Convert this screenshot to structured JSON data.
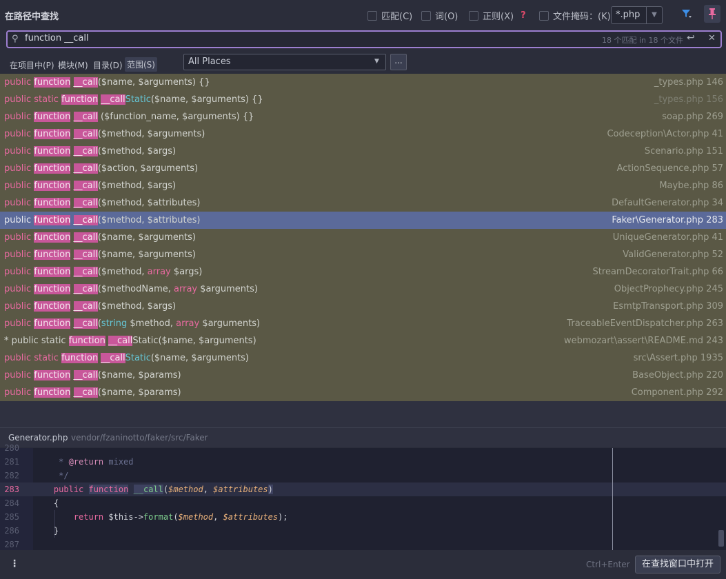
{
  "header": {
    "title": "在路径中查找",
    "options": [
      {
        "label": "匹配(C)",
        "checked": false
      },
      {
        "label": "词(O)",
        "checked": false
      },
      {
        "label": "正则(X)",
        "checked": false
      },
      {
        "label": "文件掩码：(K)",
        "checked": false
      }
    ],
    "regex_help": "?",
    "file_mask_value": "*.php",
    "filter_icon": "filter-icon",
    "pin_icon": "pin-icon"
  },
  "search": {
    "query": "function __call",
    "match_count": "18 个匹配 in 18 个文件",
    "enter_symbol": "↩",
    "close_symbol": "✕"
  },
  "scope": {
    "tabs": [
      "在项目中(P)",
      "模块(M)",
      "目录(D)",
      "范围(S)"
    ],
    "selected_tab": "范围(S)",
    "places_value": "All Places",
    "more_label": "..."
  },
  "results": [
    {
      "prefix": "public ",
      "match": [
        "function",
        "__call"
      ],
      "suffix": "($name, $arguments) {}",
      "location": "_types.php 146"
    },
    {
      "prefix": "public static ",
      "match": [
        "function",
        "__call"
      ],
      "suffix_cyan": "Static",
      "suffix": "($name, $arguments) {}",
      "location": "_types.php 156",
      "dim_location": true
    },
    {
      "prefix": "public ",
      "match": [
        "function",
        "__call"
      ],
      "suffix": " ($function_name, $arguments) {}",
      "location": "soap.php 269"
    },
    {
      "prefix": "public ",
      "match": [
        "function",
        "__call"
      ],
      "suffix": "($method, $arguments)",
      "location": "Codeception\\Actor.php 41"
    },
    {
      "prefix": "public ",
      "match": [
        "function",
        "__call"
      ],
      "suffix": "($method, $args)",
      "location": "Scenario.php 151"
    },
    {
      "prefix": "public ",
      "match": [
        "function",
        "__call"
      ],
      "suffix": "($action, $arguments)",
      "location": "ActionSequence.php 57"
    },
    {
      "prefix": "public ",
      "match": [
        "function",
        "__call"
      ],
      "suffix": "($method, $args)",
      "location": "Maybe.php 86"
    },
    {
      "prefix": "public ",
      "match": [
        "function",
        "__call"
      ],
      "suffix": "($method, $attributes)",
      "location": "DefaultGenerator.php 34"
    },
    {
      "prefix": "public ",
      "match": [
        "function",
        "__call"
      ],
      "suffix": "($method, $attributes)",
      "location": "Faker\\Generator.php 283",
      "selected": true
    },
    {
      "prefix": "public ",
      "match": [
        "function",
        "__call"
      ],
      "suffix": "($name, $arguments)",
      "location": "UniqueGenerator.php 41"
    },
    {
      "prefix": "public ",
      "match": [
        "function",
        "__call"
      ],
      "suffix": "($name, $arguments)",
      "location": "ValidGenerator.php 52"
    },
    {
      "prefix": "public ",
      "match": [
        "function",
        "__call"
      ],
      "suffix_parts": [
        "($method, ",
        "array",
        " $args)"
      ],
      "location": "StreamDecoratorTrait.php 66"
    },
    {
      "prefix": "public ",
      "match": [
        "function",
        "__call"
      ],
      "suffix_parts": [
        "($methodName, ",
        "array",
        " $arguments)"
      ],
      "location": "ObjectProphecy.php 245"
    },
    {
      "prefix": "public ",
      "match": [
        "function",
        "__call"
      ],
      "suffix": "($method, $args)",
      "location": "EsmtpTransport.php 309"
    },
    {
      "prefix": "public ",
      "match": [
        "function",
        "__call"
      ],
      "suffix_parts": [
        "(",
        "string",
        " $method, ",
        "array",
        " $arguments)"
      ],
      "location": "TraceableEventDispatcher.php 263"
    },
    {
      "bullet": "* ",
      "prefix": "public static ",
      "match": [
        "function",
        "__call"
      ],
      "suffix": "Static($name, $arguments)",
      "location": "webmozart\\assert\\README.md 243",
      "plain": true
    },
    {
      "prefix": "public static ",
      "match": [
        "function",
        "__call"
      ],
      "suffix_cyan": "Static",
      "suffix": "($name, $arguments)",
      "location": "src\\Assert.php 1935"
    },
    {
      "prefix": "public ",
      "match": [
        "function",
        "__call"
      ],
      "suffix": "($name, $params)",
      "location": "BaseObject.php 220"
    },
    {
      "prefix": "public ",
      "match": [
        "function",
        "__call"
      ],
      "suffix": "($name, $params)",
      "location": "Component.php 292"
    }
  ],
  "preview": {
    "file_name": "Generator.php",
    "file_path": "vendor/fzaninotto/faker/src/Faker",
    "lines": [
      {
        "num": "280",
        "text": ""
      },
      {
        "num": "281",
        "comment": "     * ",
        "tag": "@return",
        "tail": " mixed"
      },
      {
        "num": "282",
        "comment": "     */"
      },
      {
        "num": "283",
        "current": true,
        "kw1": "public",
        "kw2": "function",
        "fn": "__call",
        "p1": "(",
        "v1": "$method",
        "p2": ", ",
        "v2": "$attributes",
        "p3": ")"
      },
      {
        "num": "284",
        "text": "    {"
      },
      {
        "num": "285",
        "ret": "        return",
        "mid": " $this->",
        "call": "format",
        "open": "(",
        "a1": "$method",
        "sep": ", ",
        "a2": "$attributes",
        "close": ");"
      },
      {
        "num": "286",
        "text": "    }"
      },
      {
        "num": "287",
        "text": ""
      }
    ]
  },
  "footer": {
    "menu_symbol": "⋮",
    "shortcut": "Ctrl+Enter",
    "open_button": "在查找窗口中打开"
  }
}
